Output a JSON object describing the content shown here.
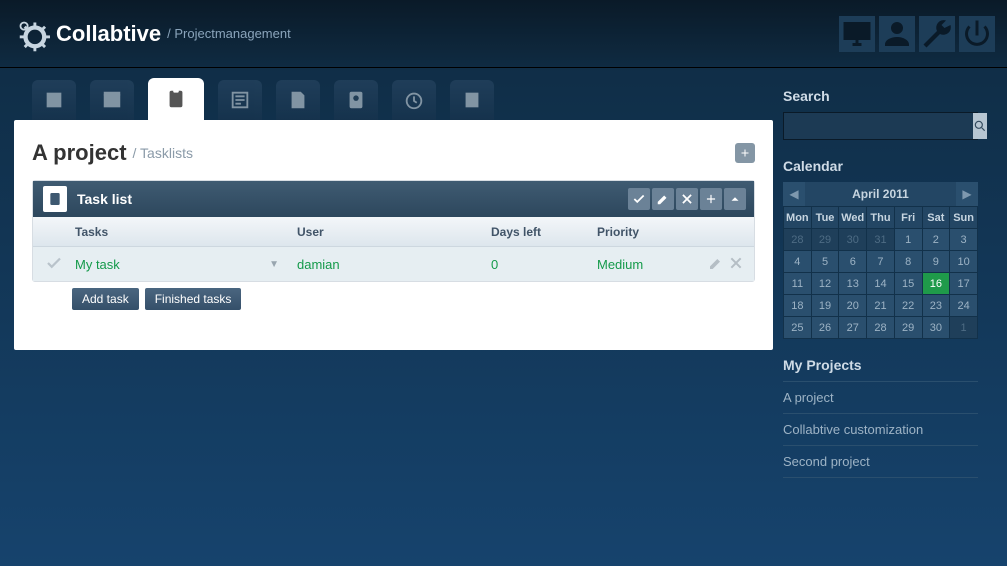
{
  "header": {
    "brand": "Collabtive",
    "breadcrumb": "/ Projectmanagement"
  },
  "panel": {
    "title": "A project",
    "breadcrumb": "/ Tasklists"
  },
  "tasklist": {
    "title": "Task list",
    "cols": {
      "tasks": "Tasks",
      "user": "User",
      "days": "Days left",
      "prio": "Priority"
    },
    "row": {
      "task": "My task",
      "user": "damian",
      "days": "0",
      "prio": "Medium"
    },
    "btn_add": "Add task",
    "btn_finished": "Finished tasks"
  },
  "sidebar": {
    "search_title": "Search",
    "calendar_title": "Calendar",
    "calendar_month": "April 2011",
    "days": [
      "Mon",
      "Tue",
      "Wed",
      "Thu",
      "Fri",
      "Sat",
      "Sun"
    ],
    "weeks": [
      [
        {
          "n": "28",
          "dim": true
        },
        {
          "n": "29",
          "dim": true
        },
        {
          "n": "30",
          "dim": true
        },
        {
          "n": "31",
          "dim": true
        },
        {
          "n": "1"
        },
        {
          "n": "2"
        },
        {
          "n": "3"
        }
      ],
      [
        {
          "n": "4"
        },
        {
          "n": "5"
        },
        {
          "n": "6"
        },
        {
          "n": "7"
        },
        {
          "n": "8"
        },
        {
          "n": "9"
        },
        {
          "n": "10"
        }
      ],
      [
        {
          "n": "11"
        },
        {
          "n": "12"
        },
        {
          "n": "13"
        },
        {
          "n": "14"
        },
        {
          "n": "15"
        },
        {
          "n": "16",
          "today": true
        },
        {
          "n": "17"
        }
      ],
      [
        {
          "n": "18"
        },
        {
          "n": "19"
        },
        {
          "n": "20"
        },
        {
          "n": "21"
        },
        {
          "n": "22"
        },
        {
          "n": "23"
        },
        {
          "n": "24"
        }
      ],
      [
        {
          "n": "25"
        },
        {
          "n": "26"
        },
        {
          "n": "27"
        },
        {
          "n": "28"
        },
        {
          "n": "29"
        },
        {
          "n": "30"
        },
        {
          "n": "1",
          "dim": true
        }
      ]
    ],
    "projects_title": "My Projects",
    "projects": [
      "A project",
      "Collabtive customization",
      "Second project"
    ]
  }
}
